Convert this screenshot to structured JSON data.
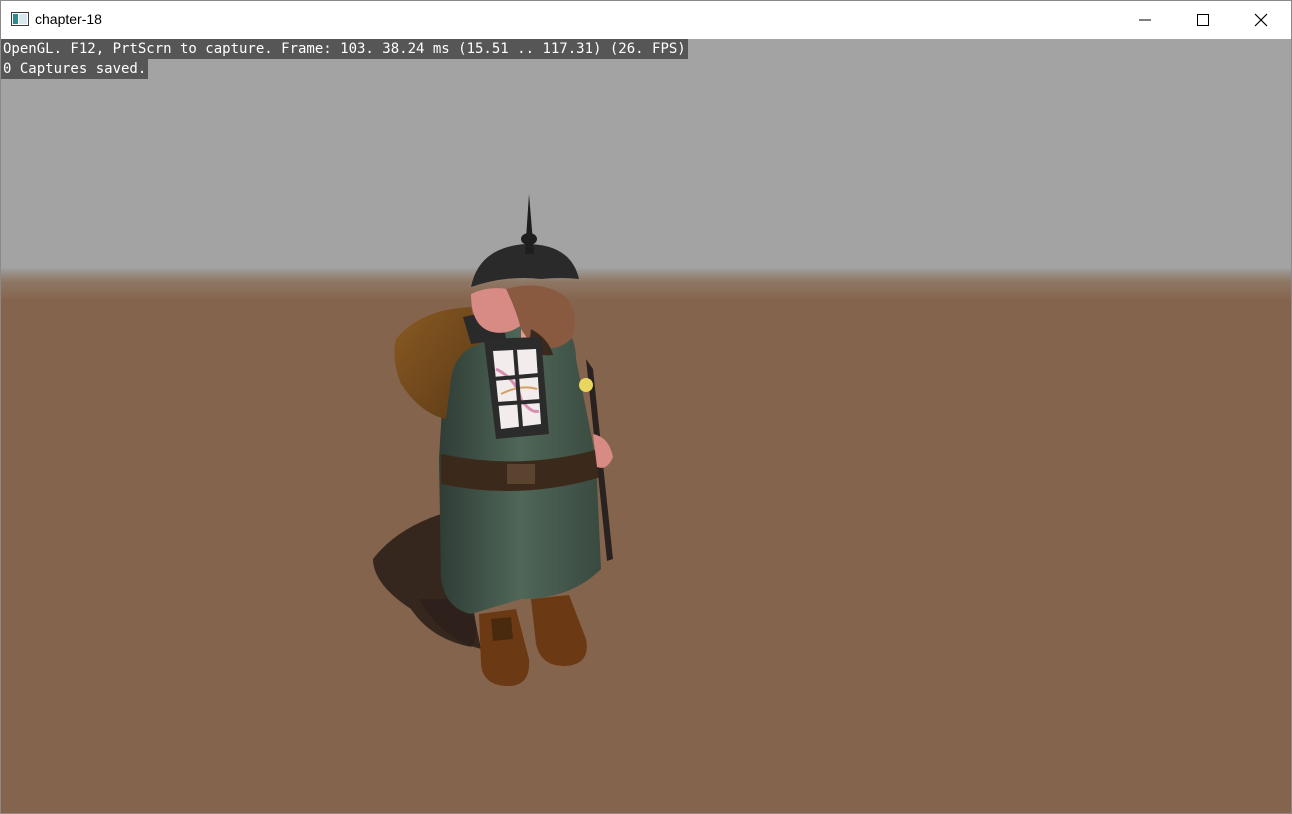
{
  "window": {
    "title": "chapter-18",
    "icon": "app-window-icon",
    "controls": {
      "minimize": "minimize-icon",
      "maximize": "maximize-icon",
      "close": "close-icon"
    }
  },
  "overlay": {
    "line1": "OpenGL. F12, PrtScrn to capture. Frame: 103. 38.24 ms (15.51 .. 117.31) (26. FPS)",
    "line2": "0 Captures saved."
  },
  "scene": {
    "sky_color": "#a3a3a3",
    "ground_color": "#85644d",
    "subject": "dwarf-character-with-lantern"
  }
}
